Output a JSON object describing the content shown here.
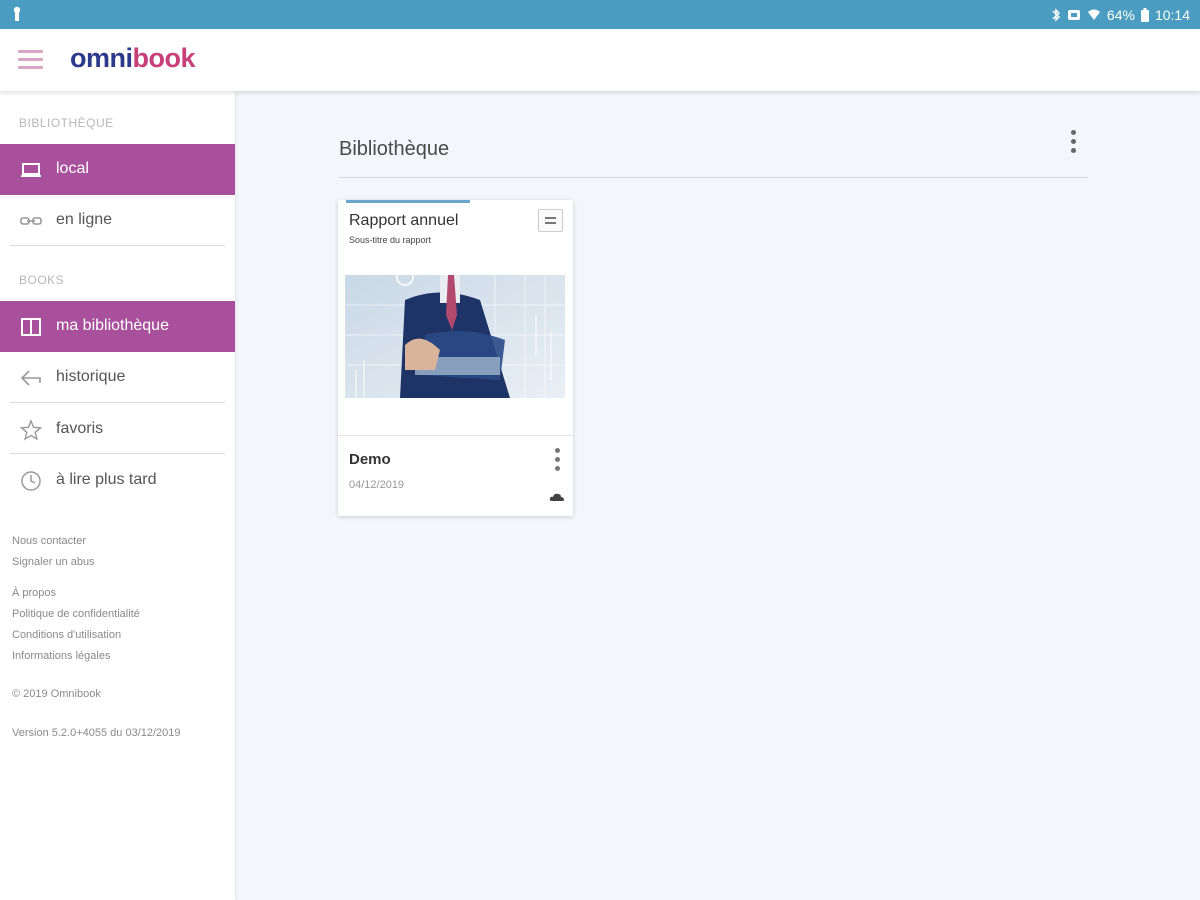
{
  "status_bar": {
    "battery": "64%",
    "time": "10:14",
    "icons": [
      "lock-icon",
      "bluetooth-icon",
      "alarm-icon",
      "wifi-icon",
      "battery-icon"
    ],
    "color": "#4a9dc0"
  },
  "app_bar": {
    "logo_part1": "omni",
    "logo_part2": "book",
    "logo_colors": [
      "#2d3a8c",
      "#c8407a"
    ]
  },
  "sidebar": {
    "section_library": "BIBLIOTHÈQUE",
    "library_items": [
      {
        "label": "local",
        "icon": "laptop-icon",
        "active": true
      },
      {
        "label": "en ligne",
        "icon": "cloud-link-icon",
        "active": false
      }
    ],
    "section_books": "BOOKS",
    "book_items": [
      {
        "label": "ma bibliothèque",
        "icon": "book-icon",
        "active": true
      },
      {
        "label": "historique",
        "icon": "history-arrow-icon",
        "active": false
      },
      {
        "label": "favoris",
        "icon": "star-icon",
        "active": false
      },
      {
        "label": "à lire plus tard",
        "icon": "clock-icon",
        "active": false
      }
    ],
    "active_color": "#a9509d",
    "footer_links": [
      "Nous contacter",
      "Signaler un abus",
      "À propos",
      "Politique de confidentialité",
      "Conditions d'utilisation",
      "Informations légales"
    ],
    "copyright": "© 2019 Omnibook",
    "version": "Version 5.2.0+4055 du 03/12/2019"
  },
  "main": {
    "title": "Bibliothèque",
    "cards": [
      {
        "title": "Rapport annuel",
        "subtitle": "Sous-titre du rapport",
        "name": "Demo",
        "date": "04/12/2019"
      }
    ]
  }
}
